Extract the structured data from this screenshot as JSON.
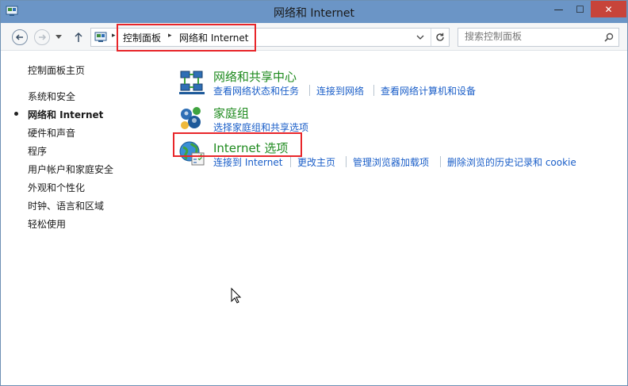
{
  "window": {
    "title": "网络和 Internet",
    "minimize_glyph": "—",
    "maximize_glyph": "☐",
    "close_glyph": "✕"
  },
  "address_bar": {
    "breadcrumb": [
      "控制面板",
      "网络和 Internet"
    ],
    "separator_glyph": "▸",
    "search_placeholder": "搜索控制面板"
  },
  "sidebar": {
    "home_label": "控制面板主页",
    "items": [
      {
        "label": "系统和安全",
        "active": false
      },
      {
        "label": "网络和 Internet",
        "active": true
      },
      {
        "label": "硬件和声音",
        "active": false
      },
      {
        "label": "程序",
        "active": false
      },
      {
        "label": "用户帐户和家庭安全",
        "active": false
      },
      {
        "label": "外观和个性化",
        "active": false
      },
      {
        "label": "时钟、语言和区域",
        "active": false
      },
      {
        "label": "轻松使用",
        "active": false
      }
    ]
  },
  "categories": [
    {
      "title": "网络和共享中心",
      "icon": "network-sharing-center-icon",
      "links": [
        "查看网络状态和任务",
        "连接到网络",
        "查看网络计算机和设备"
      ]
    },
    {
      "title": "家庭组",
      "icon": "homegroup-icon",
      "links": [
        "选择家庭组和共享选项"
      ]
    },
    {
      "title": "Internet 选项",
      "icon": "internet-options-icon",
      "links": [
        "连接到 Internet",
        "更改主页",
        "管理浏览器加载项",
        "删除浏览的历史记录和 cookie"
      ]
    }
  ],
  "colors": {
    "titlebar": "#6b95c6",
    "category_title": "#1e8a1e",
    "link": "#1a5ec8",
    "highlight": "#e8262a",
    "close_button": "#c7443a"
  }
}
